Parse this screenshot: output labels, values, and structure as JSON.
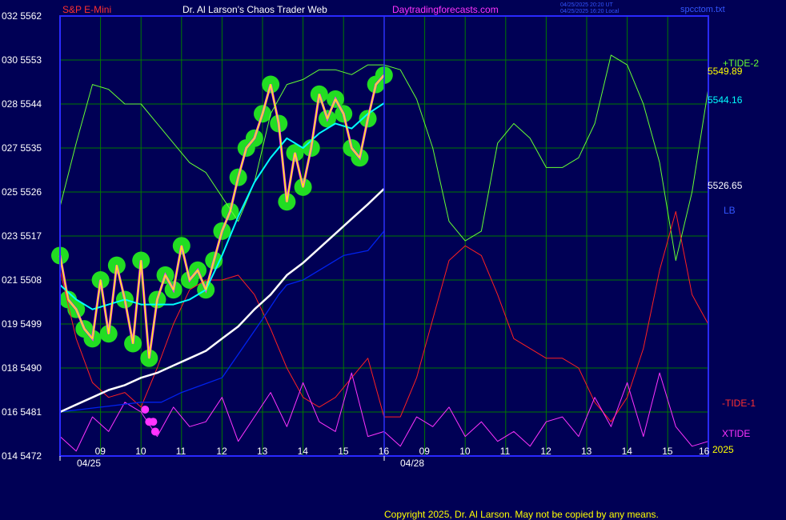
{
  "header": {
    "instrument": "S&P E-Mini",
    "site_title": "Dr. Al Larson's Chaos Trader Web",
    "site_url": "Daytradingforecasts.com",
    "timestamp_ut": "04/25/2025 20:20 UT",
    "timestamp_local": "04/25/2025 16:20 Local",
    "filename": "spcctom.txt"
  },
  "footer": {
    "copyright": "Copyright 2025, Dr. Al Larson. May not be copied by any means."
  },
  "colors": {
    "background": "#000055",
    "frame": "#2a2aff",
    "grid": "#007a00",
    "price": "#ffff00",
    "fast_ma": "#00ffff",
    "slow_ma": "#ffffff",
    "glow": "#22dd22",
    "tide_plus": "#66ff33",
    "tide_minus": "#ff2020",
    "xtide": "#ff33ff",
    "lb": "#0022ee"
  },
  "chart_data": {
    "type": "line",
    "title": "S&P E-Mini",
    "y_ticks_price": [
      "5562",
      "5553",
      "5544",
      "5535",
      "5526",
      "5517",
      "5508",
      "5499",
      "5490",
      "5481",
      "5472"
    ],
    "y_ticks_code": [
      "032",
      "030",
      "028",
      "027",
      "025",
      "023",
      "021",
      "019",
      "018",
      "016",
      "014"
    ],
    "ylim": [
      5472,
      5562
    ],
    "x_ticks_day1": [
      "09",
      "10",
      "11",
      "12",
      "13",
      "14",
      "15",
      "16"
    ],
    "x_ticks_day2": [
      "09",
      "10",
      "11",
      "12",
      "13",
      "14",
      "15",
      "16"
    ],
    "x_dates": [
      "04/25",
      "04/28"
    ],
    "year": "2025",
    "right_labels": {
      "tide_plus": "+TIDE-2",
      "price_last": "5549.89",
      "fast_ma_last": "5544.16",
      "slow_ma_last": "5526.65",
      "lb": "LB",
      "tide_minus": "-TIDE-1",
      "xtide": "XTIDE"
    },
    "series": [
      {
        "name": "price",
        "hours": [
          8.0,
          8.2,
          8.4,
          8.6,
          8.8,
          9.0,
          9.2,
          9.4,
          9.6,
          9.8,
          10.0,
          10.2,
          10.4,
          10.6,
          10.8,
          11.0,
          11.2,
          11.4,
          11.6,
          11.8,
          12.0,
          12.2,
          12.4,
          12.6,
          12.8,
          13.0,
          13.2,
          13.4,
          13.6,
          13.8,
          14.0,
          14.2,
          14.4,
          14.6,
          14.8,
          15.0,
          15.2,
          15.4,
          15.6,
          15.8,
          16.0
        ],
        "values": [
          5513,
          5504,
          5502,
          5498,
          5496,
          5508,
          5497,
          5511,
          5504,
          5495,
          5512,
          5492,
          5504,
          5509,
          5506,
          5515,
          5508,
          5510,
          5506,
          5512,
          5518,
          5522,
          5529,
          5535,
          5537,
          5542,
          5548,
          5540,
          5524,
          5534,
          5527,
          5535,
          5546,
          5541,
          5545,
          5542,
          5535,
          5533,
          5541,
          5548,
          5549.89
        ]
      },
      {
        "name": "fast_ma",
        "hours": [
          8.0,
          8.4,
          8.8,
          9.2,
          9.6,
          10.0,
          10.4,
          10.8,
          11.2,
          11.6,
          12.0,
          12.4,
          12.8,
          13.2,
          13.6,
          14.0,
          14.4,
          14.8,
          15.2,
          15.6,
          16.0
        ],
        "values": [
          5507,
          5504,
          5502,
          5503,
          5504,
          5503,
          5503,
          5503,
          5504,
          5506,
          5513,
          5521,
          5528,
          5533,
          5537,
          5535,
          5538,
          5540,
          5539,
          5542,
          5544.16
        ]
      },
      {
        "name": "slow_ma",
        "hours": [
          8.0,
          8.4,
          8.8,
          9.2,
          9.6,
          10.0,
          10.4,
          10.8,
          11.2,
          11.6,
          12.0,
          12.4,
          12.8,
          13.2,
          13.6,
          14.0,
          14.4,
          14.8,
          15.2,
          15.6,
          16.0
        ],
        "values": [
          5481,
          5482.5,
          5484,
          5485.5,
          5486.5,
          5488,
          5489,
          5490.5,
          5492,
          5493.5,
          5496,
          5498.5,
          5502,
          5505,
          5509,
          5511.5,
          5514.5,
          5517.5,
          5520.5,
          5523.5,
          5526.65
        ]
      },
      {
        "name": "lb",
        "hours": [
          8.0,
          9.0,
          10.0,
          10.5,
          11.0,
          12.0,
          13.0,
          13.4,
          13.6,
          14.0,
          14.6,
          15.0,
          15.6,
          16.0
        ],
        "values": [
          5481,
          5482,
          5483,
          5483,
          5485,
          5488,
          5500,
          5505,
          5507,
          5508,
          5511,
          5513,
          5514,
          5518
        ]
      },
      {
        "name": "tide_plus",
        "hours": [
          8.0,
          8.4,
          8.8,
          9.2,
          9.6,
          10.0,
          10.4,
          10.8,
          11.2,
          11.6,
          12.0,
          12.4,
          12.8,
          13.2,
          13.6,
          14.0,
          14.4,
          14.8,
          15.2,
          15.6,
          16.0,
          16.4,
          16.8,
          17.2,
          17.6,
          18.0,
          18.4,
          18.8,
          19.2,
          19.6,
          20.0,
          20.4,
          20.8,
          21.2,
          21.6,
          22.0,
          22.4,
          22.8,
          23.2,
          23.6,
          24.0
        ],
        "values": [
          5523,
          5536,
          5548,
          5547,
          5544,
          5544,
          5540,
          5536,
          5532,
          5530,
          5525,
          5520,
          5528,
          5542,
          5548,
          5549,
          5551,
          5551,
          5550,
          5552,
          5552,
          5551,
          5545,
          5535,
          5520,
          5516,
          5518,
          5536,
          5540,
          5537,
          5531,
          5531,
          5533,
          5540,
          5554,
          5552,
          5544,
          5532,
          5512,
          5526,
          5547
        ]
      },
      {
        "name": "tide_minus",
        "hours": [
          8.0,
          8.4,
          8.8,
          9.2,
          9.6,
          10.0,
          10.4,
          10.8,
          11.2,
          11.6,
          12.0,
          12.4,
          12.8,
          13.2,
          13.6,
          14.0,
          14.4,
          14.8,
          15.2,
          15.6,
          16.0,
          16.4,
          16.8,
          17.2,
          17.6,
          18.0,
          18.4,
          18.8,
          19.2,
          19.6,
          20.0,
          20.4,
          20.8,
          21.2,
          21.6,
          22.0,
          22.4,
          22.8,
          23.2,
          23.6,
          24.0
        ],
        "values": [
          5510,
          5496,
          5487,
          5484,
          5485,
          5482,
          5490,
          5499,
          5506,
          5508,
          5508,
          5509,
          5505,
          5498,
          5490,
          5484,
          5482,
          5484,
          5488,
          5492,
          5480,
          5480,
          5488,
          5500,
          5512,
          5515,
          5513,
          5505,
          5496,
          5494,
          5492,
          5492,
          5490,
          5483,
          5479,
          5484,
          5494,
          5510,
          5522,
          5505,
          5499
        ]
      },
      {
        "name": "xtide",
        "hours": [
          8.0,
          8.4,
          8.8,
          9.2,
          9.6,
          10.0,
          10.4,
          10.8,
          11.2,
          11.6,
          12.0,
          12.4,
          12.8,
          13.2,
          13.6,
          14.0,
          14.4,
          14.8,
          15.2,
          15.6,
          16.0,
          16.4,
          16.8,
          17.2,
          17.6,
          18.0,
          18.4,
          18.8,
          19.2,
          19.6,
          20.0,
          20.4,
          20.8,
          21.2,
          21.6,
          22.0,
          22.4,
          22.8,
          23.2,
          23.6,
          24.0
        ],
        "values": [
          5476,
          5473,
          5480,
          5477,
          5483,
          5481,
          5476,
          5482,
          5478,
          5479,
          5484,
          5475,
          5480,
          5485,
          5478,
          5487,
          5479,
          5477,
          5489,
          5476,
          5477,
          5474,
          5480,
          5478,
          5482,
          5476,
          5479,
          5475,
          5477,
          5474,
          5479,
          5480,
          5476,
          5484,
          5478,
          5487,
          5476,
          5489,
          5478,
          5474,
          5475
        ]
      }
    ]
  }
}
